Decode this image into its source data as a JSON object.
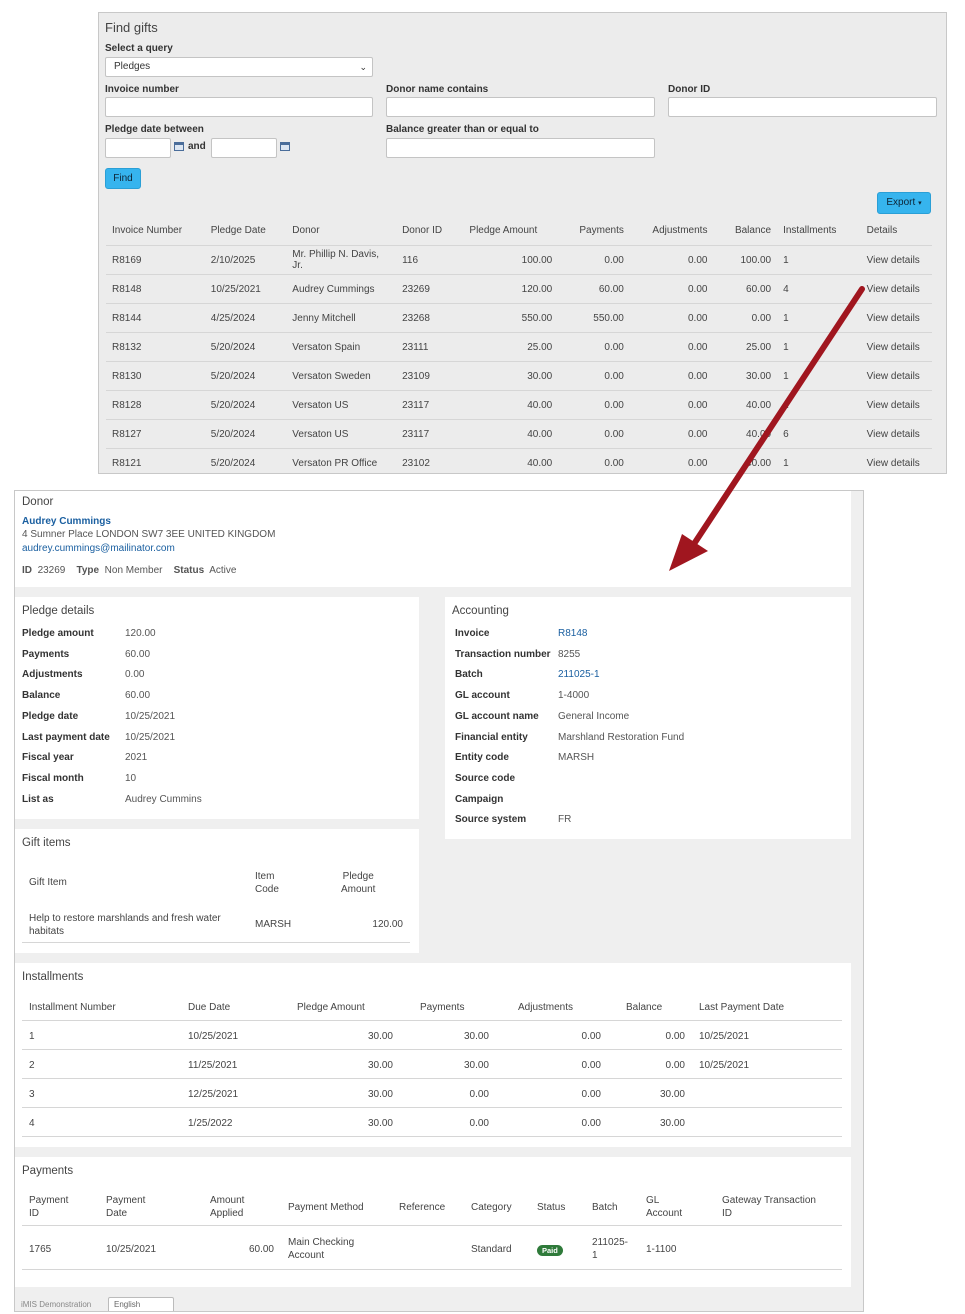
{
  "find_gifts": {
    "title": "Find gifts",
    "query_label": "Select a query",
    "query_value": "Pledges",
    "invoice_label": "Invoice number",
    "donor_name_label": "Donor name contains",
    "donor_id_label": "Donor ID",
    "pledge_date_label": "Pledge date between",
    "and_label": "and",
    "balance_label": "Balance greater than or equal to",
    "find_button": "Find",
    "export_button": "Export",
    "columns": [
      "Invoice Number",
      "Pledge Date",
      "Donor",
      "Donor ID",
      "Pledge Amount",
      "Payments",
      "Adjustments",
      "Balance",
      "Installments",
      "Details"
    ],
    "rows": [
      {
        "invoice": "R8169",
        "date": "2/10/2025",
        "donor": "Mr. Phillip N. Davis, Jr.",
        "donor_id": "116",
        "amount": "100.00",
        "payments": "0.00",
        "adjustments": "0.00",
        "balance": "100.00",
        "installments": "1",
        "details": "View details"
      },
      {
        "invoice": "R8148",
        "date": "10/25/2021",
        "donor": "Audrey Cummings",
        "donor_id": "23269",
        "amount": "120.00",
        "payments": "60.00",
        "adjustments": "0.00",
        "balance": "60.00",
        "installments": "4",
        "details": "View details"
      },
      {
        "invoice": "R8144",
        "date": "4/25/2024",
        "donor": "Jenny Mitchell",
        "donor_id": "23268",
        "amount": "550.00",
        "payments": "550.00",
        "adjustments": "0.00",
        "balance": "0.00",
        "installments": "1",
        "details": "View details"
      },
      {
        "invoice": "R8132",
        "date": "5/20/2024",
        "donor": "Versaton Spain",
        "donor_id": "23111",
        "amount": "25.00",
        "payments": "0.00",
        "adjustments": "0.00",
        "balance": "25.00",
        "installments": "1",
        "details": "View details"
      },
      {
        "invoice": "R8130",
        "date": "5/20/2024",
        "donor": "Versaton Sweden",
        "donor_id": "23109",
        "amount": "30.00",
        "payments": "0.00",
        "adjustments": "0.00",
        "balance": "30.00",
        "installments": "1",
        "details": "View details"
      },
      {
        "invoice": "R8128",
        "date": "5/20/2024",
        "donor": "Versaton US",
        "donor_id": "23117",
        "amount": "40.00",
        "payments": "0.00",
        "adjustments": "0.00",
        "balance": "40.00",
        "installments": "1",
        "details": "View details"
      },
      {
        "invoice": "R8127",
        "date": "5/20/2024",
        "donor": "Versaton US",
        "donor_id": "23117",
        "amount": "40.00",
        "payments": "0.00",
        "adjustments": "0.00",
        "balance": "40.00",
        "installments": "6",
        "details": "View details"
      },
      {
        "invoice": "R8121",
        "date": "5/20/2024",
        "donor": "Versaton PR Office",
        "donor_id": "23102",
        "amount": "40.00",
        "payments": "0.00",
        "adjustments": "0.00",
        "balance": "40.00",
        "installments": "1",
        "details": "View details"
      }
    ]
  },
  "donor": {
    "title": "Donor",
    "name": "Audrey Cummings",
    "address": "4 Sumner Place LONDON SW7 3EE UNITED KINGDOM",
    "email": "audrey.cummings@mailinator.com",
    "id_label": "ID",
    "id_value": "23269",
    "type_label": "Type",
    "type_value": "Non Member",
    "status_label": "Status",
    "status_value": "Active"
  },
  "pledge_details": {
    "title": "Pledge details",
    "items": [
      {
        "label": "Pledge amount",
        "value": "120.00"
      },
      {
        "label": "Payments",
        "value": "60.00"
      },
      {
        "label": "Adjustments",
        "value": "0.00"
      },
      {
        "label": "Balance",
        "value": "60.00"
      },
      {
        "label": "Pledge date",
        "value": "10/25/2021"
      },
      {
        "label": "Last payment date",
        "value": "10/25/2021"
      },
      {
        "label": "Fiscal year",
        "value": "2021"
      },
      {
        "label": "Fiscal month",
        "value": "10"
      },
      {
        "label": "List as",
        "value": "Audrey Cummins"
      }
    ]
  },
  "accounting": {
    "title": "Accounting",
    "items": [
      {
        "label": "Invoice",
        "value": "R8148"
      },
      {
        "label": "Transaction number",
        "value": "8255"
      },
      {
        "label": "Batch",
        "value": "211025-1"
      },
      {
        "label": "GL account",
        "value": "1-4000"
      },
      {
        "label": "GL account name",
        "value": "General Income"
      },
      {
        "label": "Financial entity",
        "value": "Marshland Restoration Fund"
      },
      {
        "label": "Entity code",
        "value": "MARSH"
      },
      {
        "label": "Source code",
        "value": ""
      },
      {
        "label": "Campaign",
        "value": ""
      },
      {
        "label": "Source system",
        "value": "FR"
      }
    ]
  },
  "gift_items": {
    "title": "Gift items",
    "col_gift_item": "Gift Item",
    "col_item_code_1": "Item",
    "col_item_code_2": "Code",
    "col_pledge_amount_1": "Pledge",
    "col_pledge_amount_2": "Amount",
    "row_desc_1": "Help to restore marshlands and fresh water",
    "row_desc_2": "habitats",
    "row_code": "MARSH",
    "row_amount": "120.00"
  },
  "installments": {
    "title": "Installments",
    "columns": [
      "Installment Number",
      "Due Date",
      "Pledge Amount",
      "Payments",
      "Adjustments",
      "Balance",
      "Last Payment Date"
    ],
    "rows": [
      {
        "num": "1",
        "due": "10/25/2021",
        "amount": "30.00",
        "payments": "30.00",
        "adjustments": "0.00",
        "balance": "0.00",
        "last": "10/25/2021"
      },
      {
        "num": "2",
        "due": "11/25/2021",
        "amount": "30.00",
        "payments": "30.00",
        "adjustments": "0.00",
        "balance": "0.00",
        "last": "10/25/2021"
      },
      {
        "num": "3",
        "due": "12/25/2021",
        "amount": "30.00",
        "payments": "0.00",
        "adjustments": "0.00",
        "balance": "30.00",
        "last": ""
      },
      {
        "num": "4",
        "due": "1/25/2022",
        "amount": "30.00",
        "payments": "0.00",
        "adjustments": "0.00",
        "balance": "30.00",
        "last": ""
      }
    ]
  },
  "payments": {
    "title": "Payments",
    "col_payment_id_1": "Payment",
    "col_payment_id_2": "ID",
    "col_payment_date_1": "Payment",
    "col_payment_date_2": "Date",
    "col_amount_1": "Amount",
    "col_amount_2": "Applied",
    "col_method": "Payment Method",
    "col_reference": "Reference",
    "col_category": "Category",
    "col_status": "Status",
    "col_batch": "Batch",
    "col_gl_1": "GL",
    "col_gl_2": "Account",
    "col_gateway_1": "Gateway Transaction",
    "col_gateway_2": "ID",
    "row": {
      "id": "1765",
      "date": "10/25/2021",
      "amount": "60.00",
      "method_1": "Main Checking",
      "method_2": "Account",
      "reference": "",
      "category": "Standard",
      "status": "Paid",
      "batch_1": "211025-",
      "batch_2": "1",
      "gl": "1-1100",
      "gateway": ""
    }
  },
  "footer": {
    "site_name": "iMIS Demonstration",
    "language": "English"
  },
  "colors": {
    "link": "#1a5fa0",
    "button_accent": "#36b4ee",
    "arrow": "#a0161f",
    "paid_badge": "#2f7a3a"
  }
}
